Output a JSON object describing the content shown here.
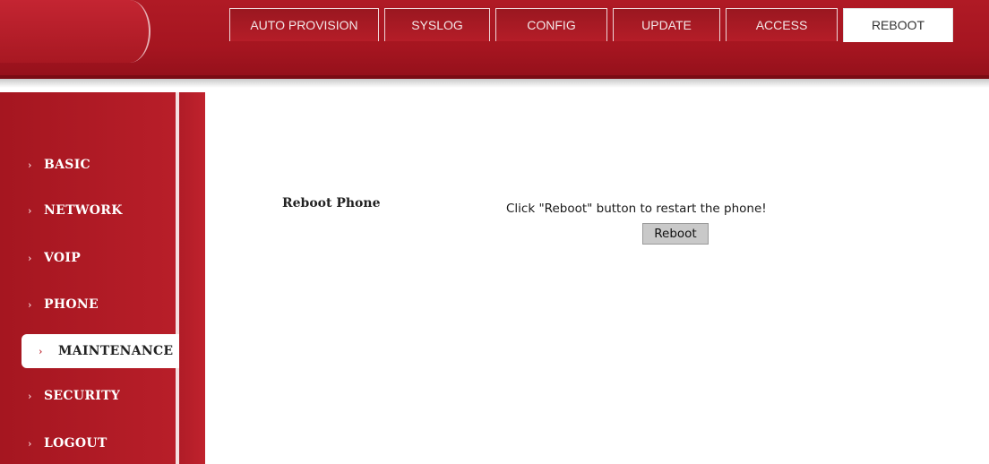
{
  "tabs": [
    {
      "label": "AUTO PROVISION",
      "active": false
    },
    {
      "label": "SYSLOG",
      "active": false
    },
    {
      "label": "CONFIG",
      "active": false
    },
    {
      "label": "UPDATE",
      "active": false
    },
    {
      "label": "ACCESS",
      "active": false
    },
    {
      "label": "REBOOT",
      "active": true
    }
  ],
  "sidebar": {
    "items": [
      {
        "label": "BASIC",
        "active": false
      },
      {
        "label": "NETWORK",
        "active": false
      },
      {
        "label": "VOIP",
        "active": false
      },
      {
        "label": "PHONE",
        "active": false
      },
      {
        "label": "MAINTENANCE",
        "active": true
      },
      {
        "label": "SECURITY",
        "active": false
      },
      {
        "label": "LOGOUT",
        "active": false
      }
    ],
    "arrow_glyph": "›"
  },
  "main": {
    "section_title": "Reboot Phone",
    "message": "Click \"Reboot\" button to restart the phone!",
    "button_label": "Reboot"
  },
  "colors": {
    "brand_red": "#a51520",
    "active_tab_bg": "#ffffff",
    "button_bg": "#c9c9c9"
  }
}
